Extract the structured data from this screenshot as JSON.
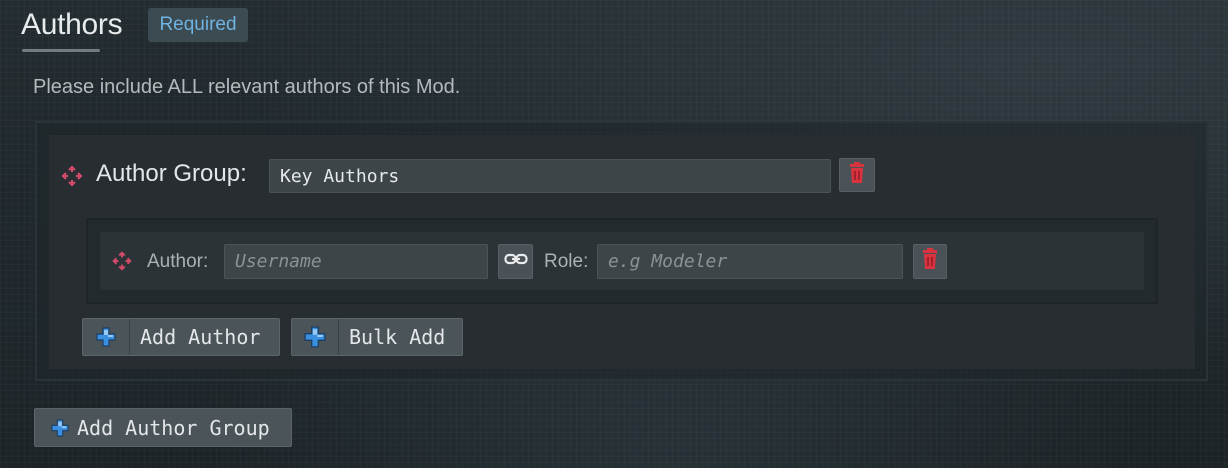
{
  "section": {
    "title": "Authors",
    "badge": "Required",
    "description": "Please include ALL relevant authors of this Mod."
  },
  "author_group": {
    "label": "Author Group:",
    "name_value": "Key Authors",
    "icons": {
      "move": "move-arrows-icon",
      "delete": "trash-icon"
    }
  },
  "author_row": {
    "author_label": "Author:",
    "author_placeholder": "Username",
    "author_value": "",
    "role_label": "Role:",
    "role_placeholder": "e.g Modeler",
    "role_value": "",
    "icons": {
      "move": "move-arrows-icon",
      "link": "link-icon",
      "delete": "trash-icon"
    }
  },
  "buttons": {
    "add_author": "Add Author",
    "bulk_add": "Bulk Add",
    "add_author_group": "Add Author Group",
    "icon": "plus-icon"
  },
  "colors": {
    "accent_blue": "#6fb3e0",
    "delete_red": "#d9333f",
    "move_icon": "#d04a6a",
    "plus_blue": "#3a8fe0"
  }
}
